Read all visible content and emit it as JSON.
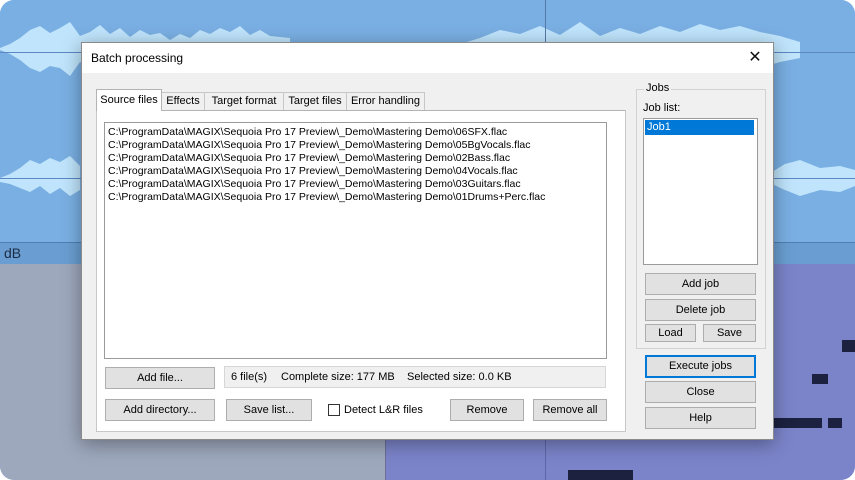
{
  "dialog": {
    "title": "Batch processing",
    "close_glyph": "✕"
  },
  "background": {
    "db_label": "dB"
  },
  "tabs": [
    {
      "label": "Source files",
      "active": true
    },
    {
      "label": "Effects"
    },
    {
      "label": "Target format"
    },
    {
      "label": "Target files"
    },
    {
      "label": "Error handling"
    }
  ],
  "source_files": [
    "C:\\ProgramData\\MAGIX\\Sequoia Pro 17 Preview\\_Demo\\Mastering Demo\\06SFX.flac",
    "C:\\ProgramData\\MAGIX\\Sequoia Pro 17 Preview\\_Demo\\Mastering Demo\\05BgVocals.flac",
    "C:\\ProgramData\\MAGIX\\Sequoia Pro 17 Preview\\_Demo\\Mastering Demo\\02Bass.flac",
    "C:\\ProgramData\\MAGIX\\Sequoia Pro 17 Preview\\_Demo\\Mastering Demo\\04Vocals.flac",
    "C:\\ProgramData\\MAGIX\\Sequoia Pro 17 Preview\\_Demo\\Mastering Demo\\03Guitars.flac",
    "C:\\ProgramData\\MAGIX\\Sequoia Pro 17 Preview\\_Demo\\Mastering Demo\\01Drums+Perc.flac"
  ],
  "buttons": {
    "add_file": "Add file...",
    "add_directory": "Add directory...",
    "save_list": "Save list...",
    "remove": "Remove",
    "remove_all": "Remove all",
    "add_job": "Add job",
    "delete_job": "Delete job",
    "load": "Load",
    "save": "Save",
    "execute_jobs": "Execute jobs",
    "close": "Close",
    "help": "Help"
  },
  "status": {
    "file_count": "6 file(s)",
    "complete_size": "Complete size: 177 MB",
    "selected_size": "Selected size: 0.0 KB"
  },
  "detect_lr": {
    "label": "Detect L&R files",
    "checked": false
  },
  "jobs": {
    "group_title": "Jobs",
    "list_label": "Job list:",
    "items": [
      "Job1"
    ]
  },
  "colors": {
    "accent": "#0078d7",
    "waveform": "#bfe4fb"
  }
}
